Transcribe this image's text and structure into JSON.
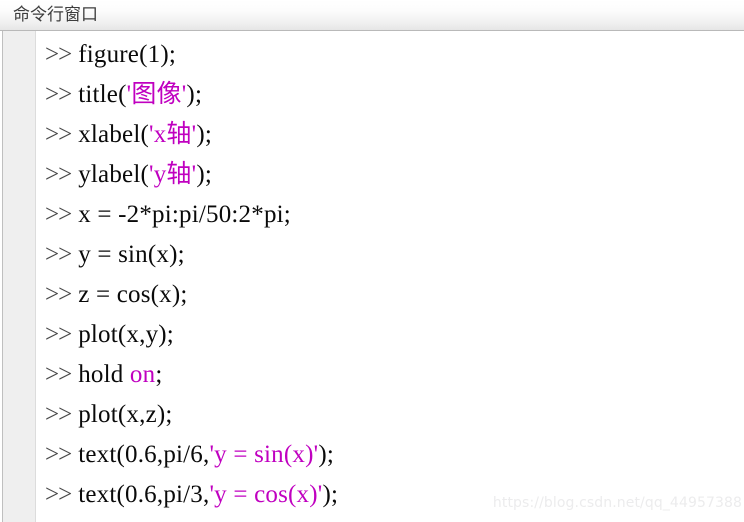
{
  "window": {
    "title": "命令行窗口",
    "prompt_symbol": ">>"
  },
  "colors": {
    "string_literal": "#c000c0",
    "code_text": "#0a0a0a",
    "prompt": "#4a4a4a",
    "titlebar_border": "#b9b9b9",
    "gutter": "#efefef",
    "watermark": "#ececed"
  },
  "console": {
    "lines": [
      {
        "prompt": ">>",
        "segments": [
          {
            "text": "figure(1);",
            "kind": "code"
          }
        ]
      },
      {
        "prompt": ">>",
        "segments": [
          {
            "text": "title(",
            "kind": "code"
          },
          {
            "text": "'图像'",
            "kind": "string"
          },
          {
            "text": ");",
            "kind": "code"
          }
        ]
      },
      {
        "prompt": ">>",
        "segments": [
          {
            "text": "xlabel(",
            "kind": "code"
          },
          {
            "text": "'x轴'",
            "kind": "string"
          },
          {
            "text": ");",
            "kind": "code"
          }
        ]
      },
      {
        "prompt": ">>",
        "segments": [
          {
            "text": "ylabel(",
            "kind": "code"
          },
          {
            "text": "'y轴'",
            "kind": "string"
          },
          {
            "text": ");",
            "kind": "code"
          }
        ]
      },
      {
        "prompt": ">>",
        "segments": [
          {
            "text": "x = -2*pi:pi/50:2*pi;",
            "kind": "code"
          }
        ]
      },
      {
        "prompt": ">>",
        "segments": [
          {
            "text": "y = sin(x);",
            "kind": "code"
          }
        ]
      },
      {
        "prompt": ">>",
        "segments": [
          {
            "text": "z = cos(x);",
            "kind": "code"
          }
        ]
      },
      {
        "prompt": ">>",
        "segments": [
          {
            "text": "plot(x,y);",
            "kind": "code"
          }
        ]
      },
      {
        "prompt": ">>",
        "segments": [
          {
            "text": "hold ",
            "kind": "code"
          },
          {
            "text": "on",
            "kind": "string"
          },
          {
            "text": ";",
            "kind": "code"
          }
        ]
      },
      {
        "prompt": ">>",
        "segments": [
          {
            "text": "plot(x,z);",
            "kind": "code"
          }
        ]
      },
      {
        "prompt": ">>",
        "segments": [
          {
            "text": "text(0.6,pi/6,",
            "kind": "code"
          },
          {
            "text": "'y = sin(x)'",
            "kind": "string"
          },
          {
            "text": ");",
            "kind": "code"
          }
        ]
      },
      {
        "prompt": ">>",
        "segments": [
          {
            "text": "text(0.6,pi/3,",
            "kind": "code"
          },
          {
            "text": "'y = cos(x)'",
            "kind": "string"
          },
          {
            "text": ");",
            "kind": "code"
          }
        ]
      }
    ]
  },
  "watermark": {
    "text": "https://blog.csdn.net/qq_44957388"
  }
}
